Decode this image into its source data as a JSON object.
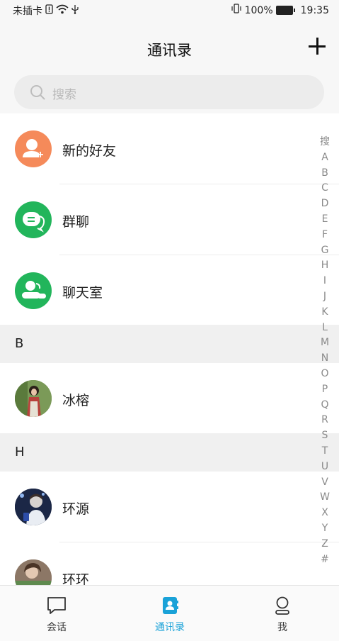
{
  "status_bar": {
    "carrier": "未插卡",
    "battery_percent": "100%",
    "time": "19:35"
  },
  "header": {
    "title": "通讯录"
  },
  "search": {
    "placeholder": "搜索"
  },
  "function_items": [
    {
      "label": "新的好友",
      "icon": "new-friend-icon",
      "color": "#f58a5a"
    },
    {
      "label": "群聊",
      "icon": "group-chat-icon",
      "color": "#22b55b"
    },
    {
      "label": "聊天室",
      "icon": "chatroom-icon",
      "color": "#22b55b"
    }
  ],
  "sections": [
    {
      "letter": "B",
      "contacts": [
        {
          "name": "冰榕"
        }
      ]
    },
    {
      "letter": "H",
      "contacts": [
        {
          "name": "环源"
        },
        {
          "name": "环环"
        }
      ]
    }
  ],
  "alphabet_index": [
    "搜",
    "A",
    "B",
    "C",
    "D",
    "E",
    "F",
    "G",
    "H",
    "I",
    "J",
    "K",
    "L",
    "M",
    "N",
    "O",
    "P",
    "Q",
    "R",
    "S",
    "T",
    "U",
    "V",
    "W",
    "X",
    "Y",
    "Z",
    "#"
  ],
  "tabs": [
    {
      "label": "会话",
      "icon": "chat-bubble-icon",
      "active": false
    },
    {
      "label": "通讯录",
      "icon": "contacts-book-icon",
      "active": true
    },
    {
      "label": "我",
      "icon": "profile-icon",
      "active": false
    }
  ],
  "colors": {
    "accent": "#1aa2d8",
    "orange": "#f58a5a",
    "green": "#22b55b"
  }
}
